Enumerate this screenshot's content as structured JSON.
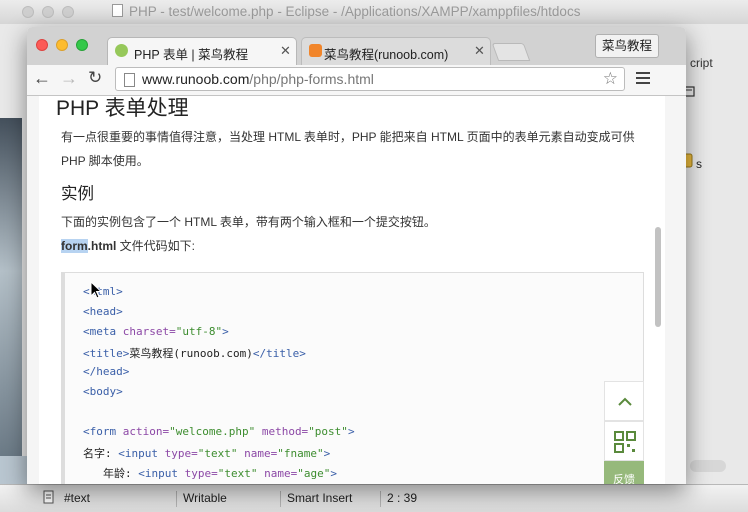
{
  "eclipse": {
    "title": "PHP - test/welcome.php - Eclipse - /Applications/XAMPP/xamppfiles/htdocs",
    "right_panel_text": "cript",
    "right_panel_item": "s",
    "status": {
      "field1": "#text",
      "field2": "Writable",
      "field3": "Smart Insert",
      "field4": "2 : 39"
    }
  },
  "browser": {
    "tabs": [
      {
        "label": "PHP 表单 | 菜鸟教程",
        "active": true
      },
      {
        "label": "菜鸟教程(runoob.com)",
        "active": false
      }
    ],
    "profile_button": "菜鸟教程",
    "url_host": "www.runoob.com",
    "url_path": "/php/php-forms.html"
  },
  "page": {
    "heading": "PHP 表单处理",
    "intro_line1": "有一点很重要的事情值得注意，当处理 HTML 表单时，PHP 能把来自 HTML 页面中的表单元素自动变成可供",
    "intro_line2": "PHP 脚本使用。",
    "example_heading": "实例",
    "example_desc": "下面的实例包含了一个 HTML 表单，带有两个输入框和一个提交按钮。",
    "file_name_hl": "form",
    "file_name_rest": ".html",
    "file_desc": " 文件代码如下:",
    "code": {
      "l1": "<html>",
      "l2": "<head>",
      "l3_tag": "<meta",
      "l3_attr": " charset=",
      "l3_str": "\"utf-8\"",
      "l3_end": ">",
      "l4_open": "<title>",
      "l4_text": "菜鸟教程(runoob.com)",
      "l4_close": "</title>",
      "l5": "</head>",
      "l6": "<body>",
      "l7_tag": "<form",
      "l7_attr1": " action=",
      "l7_str1": "\"welcome.php\"",
      "l7_attr2": " method=",
      "l7_str2": "\"post\"",
      "l7_end": ">",
      "l8_text": "名字: ",
      "l8_tag": "<input",
      "l8_attr1": " type=",
      "l8_str1": "\"text\"",
      "l8_attr2": " name=",
      "l8_str2": "\"fname\"",
      "l8_end": ">",
      "l9_text": "年龄: ",
      "l9_tag": "<input",
      "l9_attr1": " type=",
      "l9_str1": "\"text\"",
      "l9_attr2": " name=",
      "l9_str2": "\"age\"",
      "l9_end": ">"
    },
    "feedback_label": "反馈"
  }
}
